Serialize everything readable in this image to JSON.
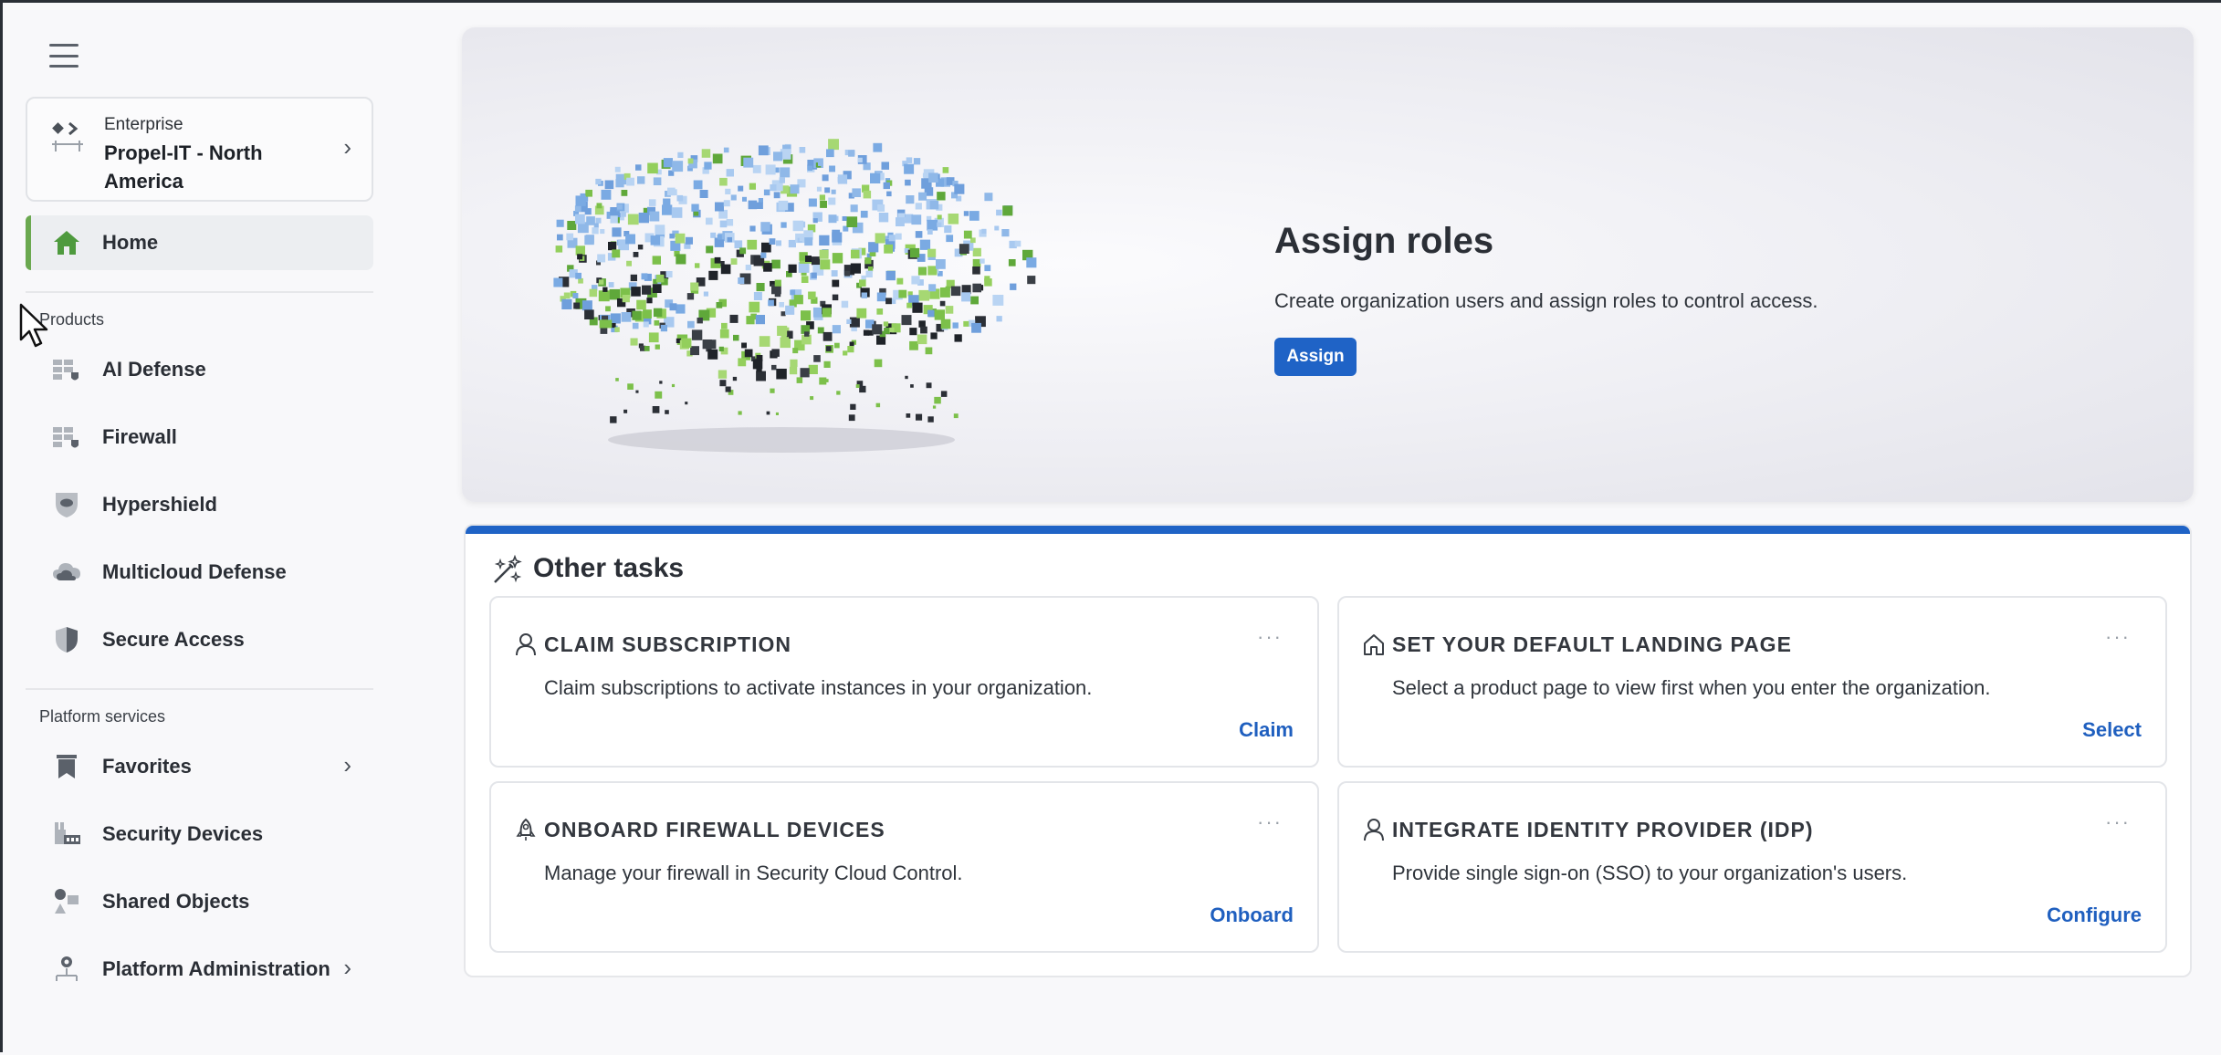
{
  "sidebar": {
    "org": {
      "kind": "Enterprise",
      "name": "Propel-IT - North America"
    },
    "home_label": "Home",
    "products_heading": "Products",
    "products": [
      {
        "label": "AI Defense",
        "icon": "ai-defense-icon"
      },
      {
        "label": "Firewall",
        "icon": "firewall-icon"
      },
      {
        "label": "Hypershield",
        "icon": "hypershield-icon"
      },
      {
        "label": "Multicloud Defense",
        "icon": "cloud-icon"
      },
      {
        "label": "Secure Access",
        "icon": "shield-icon"
      }
    ],
    "platform_heading": "Platform services",
    "platform": [
      {
        "label": "Favorites",
        "icon": "bookmark-icon",
        "has_chevron": true
      },
      {
        "label": "Security Devices",
        "icon": "devices-icon",
        "has_chevron": false
      },
      {
        "label": "Shared Objects",
        "icon": "shapes-icon",
        "has_chevron": false
      },
      {
        "label": "Platform Administration",
        "icon": "admin-gear-icon",
        "has_chevron": true
      }
    ]
  },
  "hero": {
    "title": "Assign roles",
    "description": "Create organization users and assign roles to control access.",
    "button_label": "Assign"
  },
  "tasks": {
    "title": "Other tasks",
    "items": [
      {
        "title": "CLAIM SUBSCRIPTION",
        "description": "Claim subscriptions to activate instances in your organization.",
        "action": "Claim",
        "icon": "user-icon"
      },
      {
        "title": "SET YOUR DEFAULT LANDING PAGE",
        "description": "Select a product page to view first when you enter the organization.",
        "action": "Select",
        "icon": "home-outline-icon"
      },
      {
        "title": "ONBOARD FIREWALL DEVICES",
        "description": "Manage your firewall in Security Cloud Control.",
        "action": "Onboard",
        "icon": "rocket-icon"
      },
      {
        "title": "INTEGRATE IDENTITY PROVIDER (IDP)",
        "description": "Provide single sign-on (SSO) to your organization's users.",
        "action": "Configure",
        "icon": "user-icon"
      }
    ],
    "more_label": "···"
  },
  "colors": {
    "accent_blue": "#1f63c6",
    "home_indicator_green": "#6aa84f",
    "link_blue": "#1f5fbf"
  }
}
